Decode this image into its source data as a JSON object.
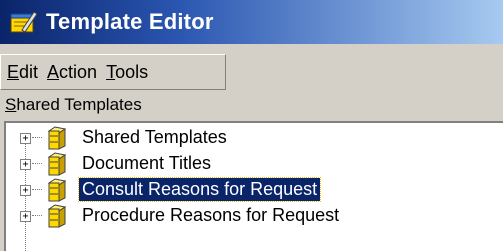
{
  "window": {
    "title": "Template Editor"
  },
  "menu": {
    "items": [
      "Edit",
      "Action",
      "Tools"
    ]
  },
  "section_label": "Shared Templates",
  "tree": {
    "nodes": [
      {
        "label": "Shared Templates",
        "expander": "+",
        "icon": "book-stack-icon",
        "selected": false
      },
      {
        "label": "Document Titles",
        "expander": "+",
        "icon": "book-stack-icon",
        "selected": false
      },
      {
        "label": "Consult Reasons for Request",
        "expander": "+",
        "icon": "book-stack-icon",
        "selected": true
      },
      {
        "label": "Procedure Reasons for Request",
        "expander": "+",
        "icon": "book-stack-icon",
        "selected": false
      }
    ]
  },
  "colors": {
    "titlebar": "#0a246a",
    "selection": "#0a246a",
    "face": "#d4d0c8",
    "icon": "#ffd800"
  }
}
